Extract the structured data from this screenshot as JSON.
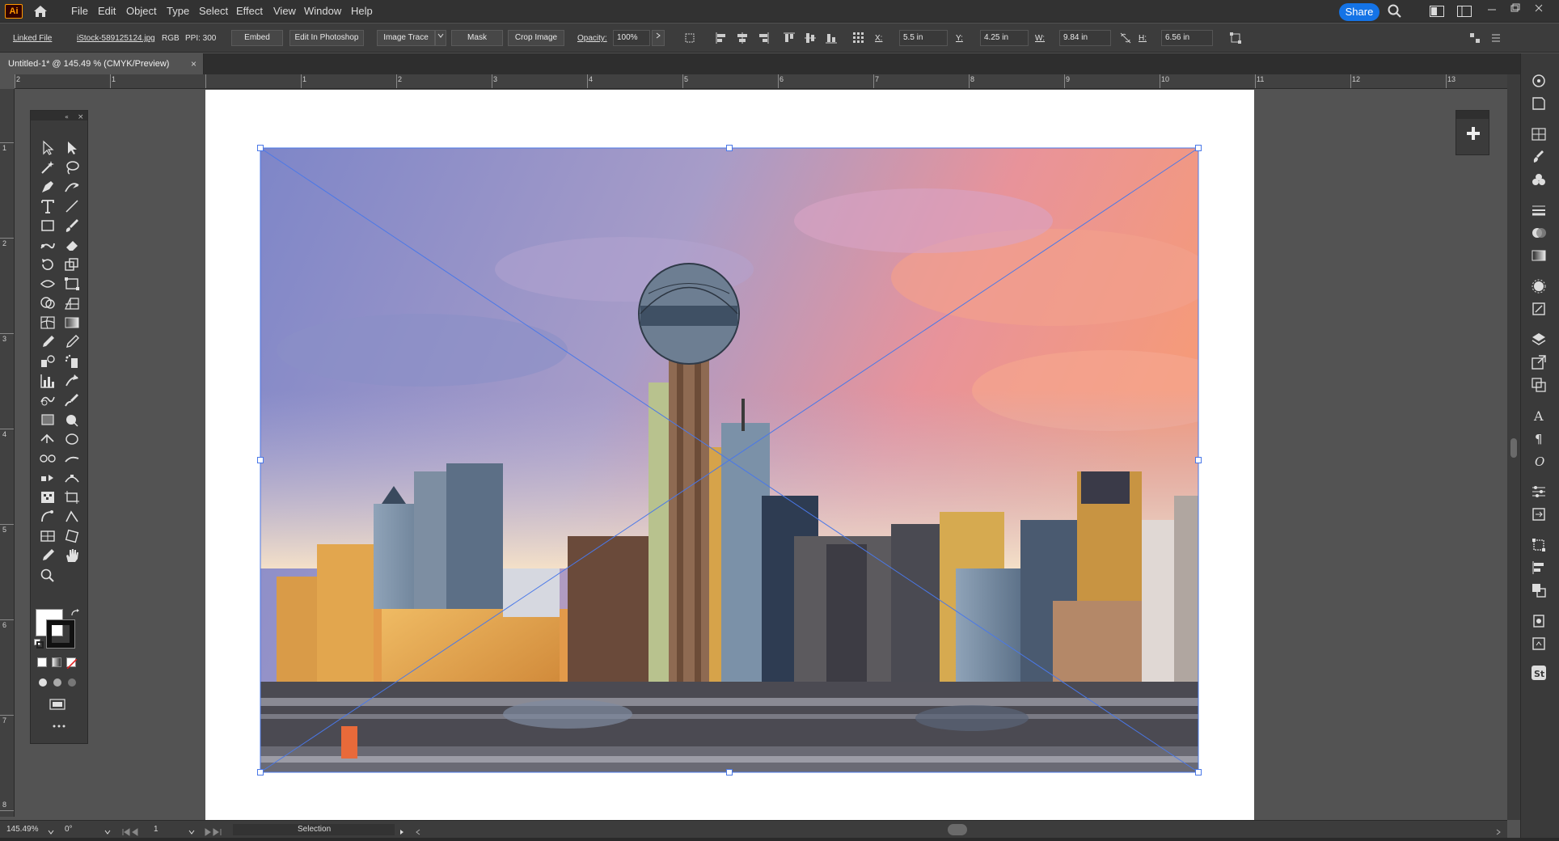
{
  "app": {
    "logo": "Ai",
    "menu": [
      "File",
      "Edit",
      "Object",
      "Type",
      "Select",
      "Effect",
      "View",
      "Window",
      "Help"
    ],
    "share_label": "Share"
  },
  "control_bar": {
    "linked_file_label": "Linked File",
    "file_name": "iStock-589125124.jpg",
    "color_mode": "RGB",
    "ppi": "PPI: 300",
    "embed": "Embed",
    "edit_in_photoshop": "Edit In Photoshop",
    "image_trace": "Image Trace",
    "mask": "Mask",
    "crop_image": "Crop Image",
    "opacity_label": "Opacity:",
    "opacity_value": "100%",
    "x_label": "X:",
    "x_value": "5.5 in",
    "y_label": "Y:",
    "y_value": "4.25 in",
    "w_label": "W:",
    "w_value": "9.84 in",
    "h_label": "H:",
    "h_value": "6.56 in"
  },
  "document": {
    "tab_title": "Untitled-1* @ 145.49 % (CMYK/Preview)",
    "close_glyph": "×"
  },
  "ruler": {
    "top_numbers": [
      "2",
      "1",
      "1",
      "2",
      "3",
      "4",
      "5",
      "6",
      "7",
      "8",
      "9",
      "10",
      "11",
      "12",
      "13"
    ],
    "left_numbers": [
      "1",
      "2",
      "3",
      "4",
      "5",
      "6",
      "7",
      "8"
    ]
  },
  "status_bar": {
    "zoom": "145.49%",
    "rotation": "0°",
    "artboard_number": "1",
    "tool_name": "Selection"
  },
  "colors": {
    "selection": "#4a78e8",
    "share_button": "#1473e6",
    "logo_orange": "#ff9a00"
  },
  "icons": {
    "tools": [
      "selection-tool-icon",
      "direct-selection-tool-icon",
      "magic-wand-icon",
      "lasso-icon",
      "pen-tool-icon",
      "curvature-icon",
      "type-tool-icon",
      "line-tool-icon",
      "rectangle-tool-icon",
      "paintbrush-icon",
      "shaper-icon",
      "eraser-icon",
      "rotate-icon",
      "scale-icon",
      "width-icon",
      "free-transform-icon",
      "shape-builder-icon",
      "perspective-grid-icon",
      "mesh-icon",
      "gradient-icon",
      "eyedropper-icon",
      "measure-icon",
      "blend-icon",
      "symbol-sprayer-icon",
      "column-graph-icon",
      "artboard-tool-icon",
      "slice-icon",
      "hand-tool-icon",
      "zoom-icon"
    ]
  }
}
